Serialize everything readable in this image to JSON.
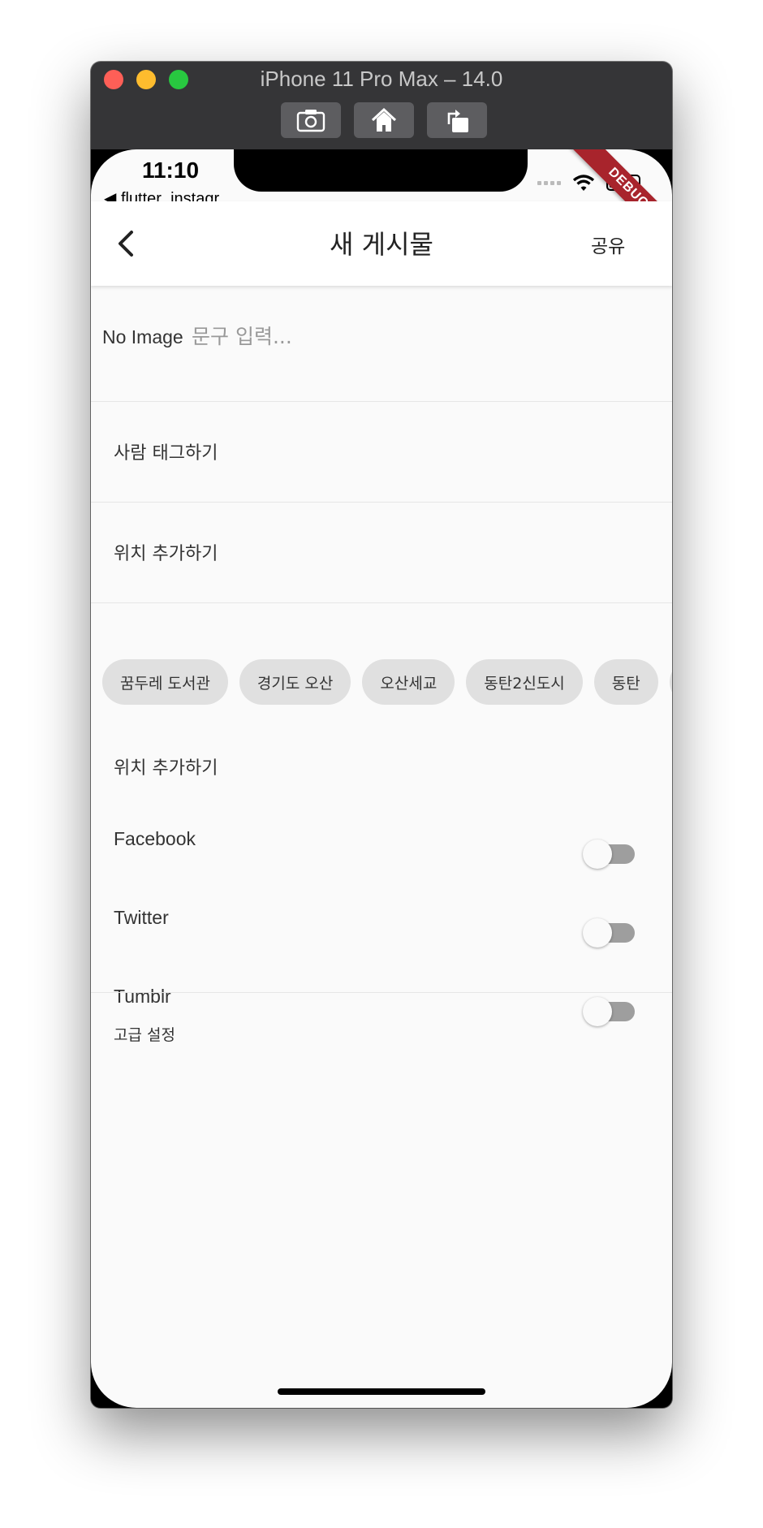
{
  "window": {
    "title": "iPhone 11 Pro Max – 14.0",
    "toolbar": [
      "screenshot-icon",
      "home-icon",
      "rotate-icon"
    ]
  },
  "status_bar": {
    "time": "11:10",
    "back_app": "◀ flutter_instagr...",
    "debug": "DEBUG"
  },
  "app_bar": {
    "back_icon": "chevron-left-icon",
    "title": "새 게시물",
    "share_label": "공유"
  },
  "caption": {
    "no_image": "No Image",
    "placeholder": "문구 입력..."
  },
  "menu": {
    "tag_people": "사람 태그하기",
    "add_location": "위치 추가하기"
  },
  "location_chips": [
    "꿈두레 도서관",
    "경기도 오산",
    "오산세교",
    "동탄2신도시",
    "동탄"
  ],
  "location_label_2": "위치 추가하기",
  "share_targets": [
    {
      "label": "Facebook",
      "on": false
    },
    {
      "label": "Twitter",
      "on": false
    },
    {
      "label": "Tumblr",
      "on": false
    }
  ],
  "advanced_settings": "고급 설정",
  "colors": {
    "toggle_track_off": "#9e9e9e",
    "chip_bg": "#e0e0e0",
    "background": "#fafafa",
    "debug_banner": "#a8242c"
  }
}
